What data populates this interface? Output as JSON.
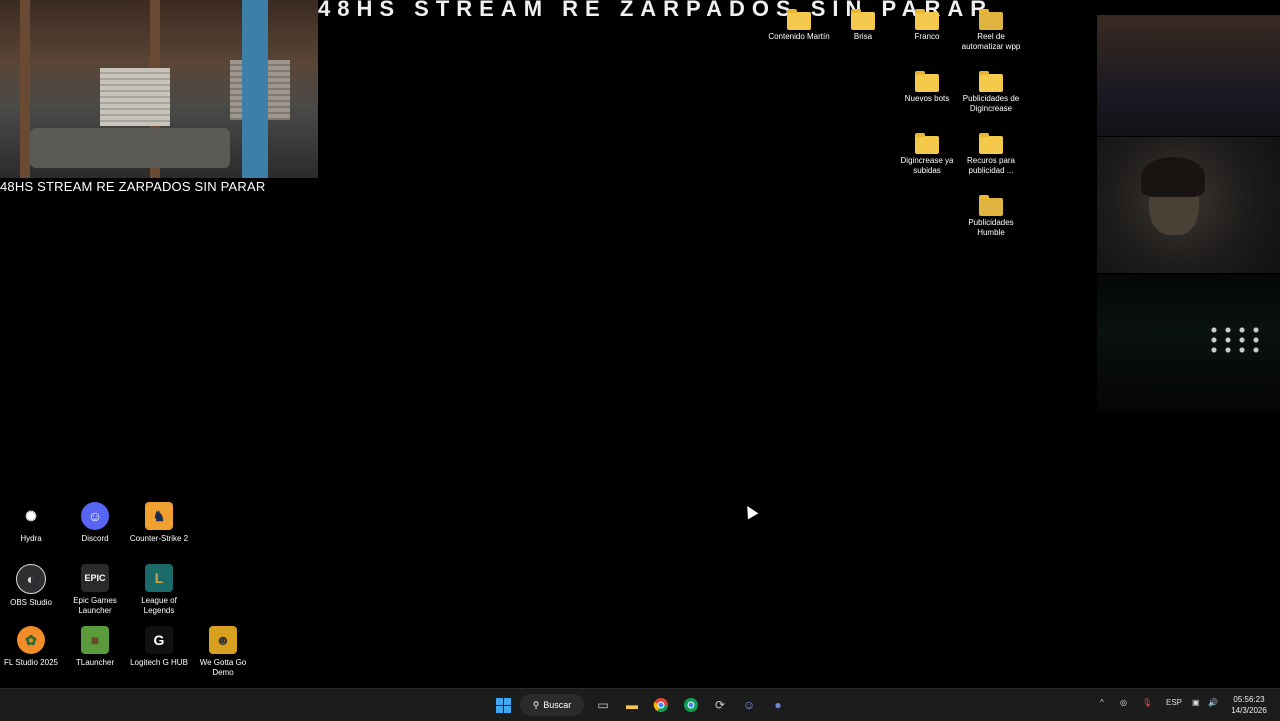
{
  "overlay": {
    "banner": "48HS STREAM RE ZARPADOS SIN PARAR",
    "caption": "48HS STREAM RE ZARPADOS SIN PARAR"
  },
  "desktop_top_icons": [
    {
      "label": "Contenido Martín",
      "icon": "folder-icon"
    },
    {
      "label": "Brisa",
      "icon": "folder-icon"
    },
    {
      "label": "Franco",
      "icon": "folder-icon"
    },
    {
      "label": "Reel de automatizar wpp",
      "icon": "folder-icon"
    },
    {
      "label": "Nuevos bots",
      "icon": "folder-icon"
    },
    {
      "label": "Publicidades de Digincrease",
      "icon": "folder-icon"
    },
    {
      "label": "Digincrease ya subidas",
      "icon": "folder-icon"
    },
    {
      "label": "Recuros para publicidad ...",
      "icon": "folder-icon"
    },
    {
      "label": "Publicidades Humble",
      "icon": "folder-icon"
    }
  ],
  "desktop_apps": [
    {
      "label": "Hydra",
      "icon": "hydra-icon",
      "color": "#ffffff"
    },
    {
      "label": "Discord",
      "icon": "discord-icon",
      "color": "#5865f2"
    },
    {
      "label": "Counter-Strike 2",
      "icon": "counter-strike-icon",
      "color": "#f0a030"
    },
    {
      "label": "OBS Studio",
      "icon": "obs-icon",
      "color": "#302e31"
    },
    {
      "label": "Epic Games Launcher",
      "icon": "epic-games-icon",
      "color": "#2a2a2a"
    },
    {
      "label": "League of Legends",
      "icon": "league-icon",
      "color": "#1b6a6a"
    },
    {
      "label": "FL Studio 2025",
      "icon": "fl-studio-icon",
      "color": "#f28c28"
    },
    {
      "label": "TLauncher",
      "icon": "tlauncher-icon",
      "color": "#5a9a3a"
    },
    {
      "label": "Logitech G HUB",
      "icon": "logitech-icon",
      "color": "#111111"
    },
    {
      "label": "We Gotta Go Demo",
      "icon": "we-gotta-go-icon",
      "color": "#d8a020"
    }
  ],
  "taskbar": {
    "search_label": "Buscar",
    "language": "ESP",
    "time": "05:56:23",
    "date": "14/3/2026",
    "accent": "#3ea8f0"
  }
}
